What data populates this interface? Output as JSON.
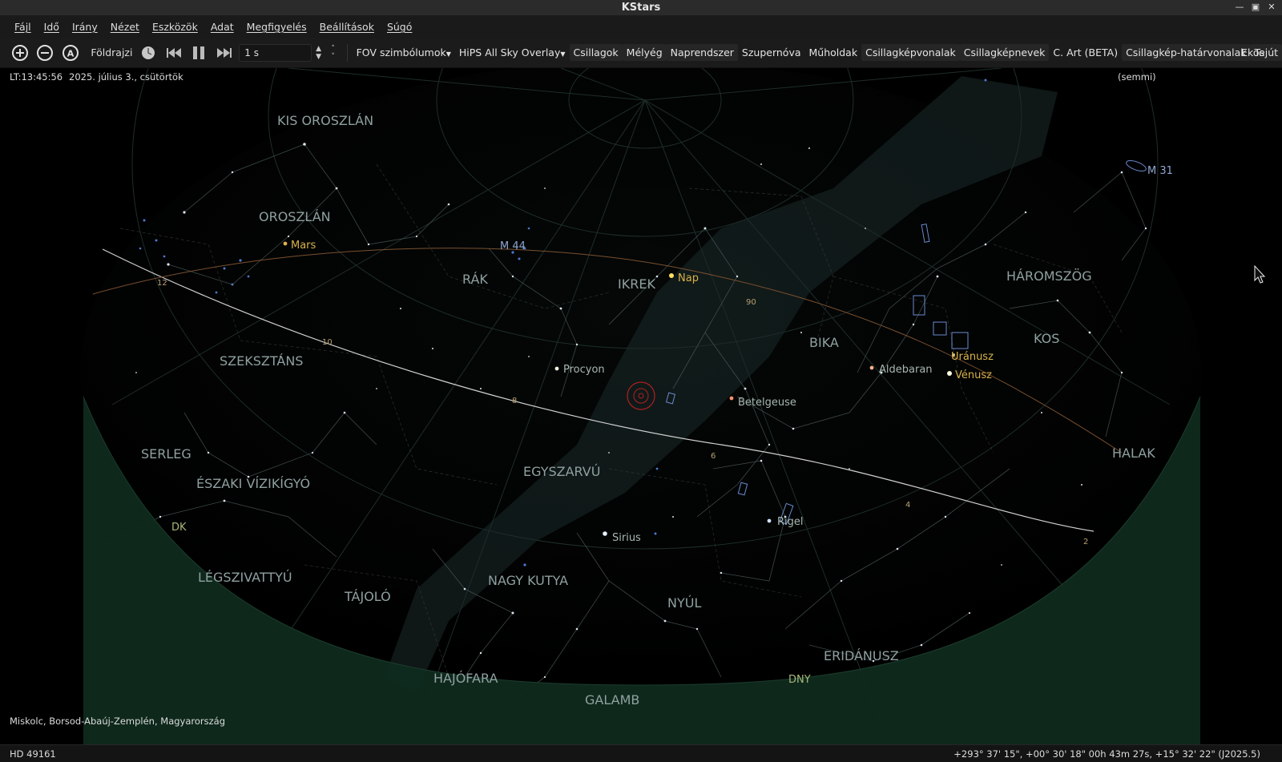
{
  "window": {
    "title": "KStars"
  },
  "menu": [
    "Fájl",
    "Idő",
    "Irány",
    "Nézet",
    "Eszközök",
    "Adat",
    "Megfigyelés",
    "Beállítások",
    "Súgó"
  ],
  "toolbar": {
    "projection": "Földrajzi",
    "time_step": "1 s",
    "fov_symbols": "FOV szimbólumok",
    "hips_overlay": "HiPS All Sky Overlay",
    "toggles": [
      "Csillagok",
      "Mélyég",
      "Naprendszer",
      "Szupernóva",
      "Műholdak",
      "Csillagképvonalak",
      "Csillagképnevek",
      "C. Art (BETA)",
      "Csillagkép-határvonalak",
      "Tejút"
    ],
    "ekos": "Ekos"
  },
  "sky": {
    "time": "LT:13:45:56",
    "date": "2025. július 3., csütörtök",
    "focus": "(semmi)",
    "location": "Miskolc, Borsod-Abaúj-Zemplén, Magyarország",
    "constellations": [
      "KIS OROSZLÁN",
      "OROSZLÁN",
      "RÁK",
      "IKREK",
      "SZEKSZTÁNS",
      "SERLEG",
      "ÉSZAKI VÍZIKÍGYÓ",
      "EGYSZARVÚ",
      "LÉGSZIVATTYÚ",
      "TÁJOLÓ",
      "NAGY KUTYA",
      "NYÚL",
      "HAJÓFARA",
      "GALAMB",
      "ERIDÁNUSZ",
      "BIKA",
      "KOS",
      "HÁROMSZÖG",
      "HALAK"
    ],
    "stars": [
      "Procyon",
      "Betelgeuse",
      "Aldebaran",
      "Sirius",
      "Rigel"
    ],
    "planets": [
      "Mars",
      "Nap",
      "Uránusz",
      "Vénusz"
    ],
    "deep_sky": [
      "M 44",
      "M 31"
    ],
    "ecliptic_ticks": [
      "12",
      "10",
      "8",
      "6",
      "4",
      "2",
      "90"
    ],
    "directions": [
      "DK",
      "DNY"
    ]
  },
  "status": {
    "object": "HD 49161",
    "coords": "+293° 37' 15\", +00° 30' 18\"  00h 43m 27s, +15° 32' 22\" (J2025.5)"
  }
}
